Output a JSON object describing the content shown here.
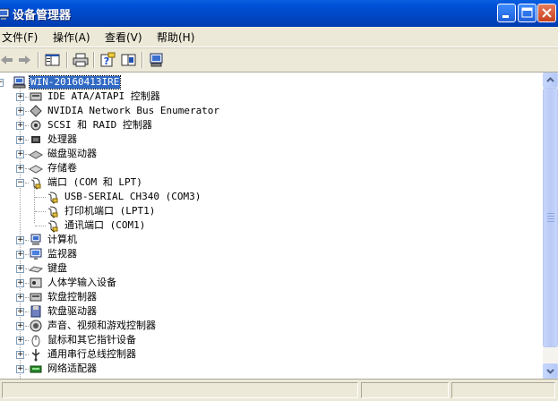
{
  "window": {
    "title": "设备管理器"
  },
  "menu": {
    "items": [
      "文件(F)",
      "操作(A)",
      "查看(V)",
      "帮助(H)"
    ]
  },
  "toolbar": {
    "buttons": [
      {
        "name": "back-icon"
      },
      {
        "name": "forward-icon"
      },
      {
        "name": "show-hide-tree-icon"
      },
      {
        "name": "print-icon"
      },
      {
        "name": "help-icon"
      },
      {
        "name": "properties-icon"
      },
      {
        "name": "scan-hardware-icon"
      }
    ]
  },
  "tree": {
    "root": "WIN-20160413IRE",
    "items": [
      {
        "label": "IDE ATA/ATAPI 控制器",
        "icon": "ide-controller-icon",
        "expanded": false
      },
      {
        "label": "NVIDIA Network Bus Enumerator",
        "icon": "network-bus-icon",
        "expanded": false
      },
      {
        "label": "SCSI 和 RAID 控制器",
        "icon": "scsi-controller-icon",
        "expanded": false
      },
      {
        "label": "处理器",
        "icon": "processor-icon",
        "expanded": false
      },
      {
        "label": "磁盘驱动器",
        "icon": "disk-drive-icon",
        "expanded": false
      },
      {
        "label": "存储卷",
        "icon": "storage-volume-icon",
        "expanded": false
      },
      {
        "label": "端口 (COM 和 LPT)",
        "icon": "port-icon",
        "expanded": true,
        "children": [
          {
            "label": "USB-SERIAL CH340 (COM3)",
            "icon": "port-icon"
          },
          {
            "label": "打印机端口 (LPT1)",
            "icon": "port-icon"
          },
          {
            "label": "通讯端口 (COM1)",
            "icon": "port-icon"
          }
        ]
      },
      {
        "label": "计算机",
        "icon": "computer-icon",
        "expanded": false
      },
      {
        "label": "监视器",
        "icon": "monitor-icon",
        "expanded": false
      },
      {
        "label": "键盘",
        "icon": "keyboard-icon",
        "expanded": false
      },
      {
        "label": "人体学输入设备",
        "icon": "hid-icon",
        "expanded": false
      },
      {
        "label": "软盘控制器",
        "icon": "floppy-controller-icon",
        "expanded": false
      },
      {
        "label": "软盘驱动器",
        "icon": "floppy-drive-icon",
        "expanded": false
      },
      {
        "label": "声音、视频和游戏控制器",
        "icon": "sound-icon",
        "expanded": false
      },
      {
        "label": "鼠标和其它指针设备",
        "icon": "mouse-icon",
        "expanded": false
      },
      {
        "label": "通用串行总线控制器",
        "icon": "usb-icon",
        "expanded": false
      },
      {
        "label": "网络适配器",
        "icon": "network-adapter-icon",
        "expanded": false
      }
    ]
  },
  "colors": {
    "titlebar": "#0050d8",
    "selection": "#316ac5",
    "window_bg": "#ece9d8"
  }
}
